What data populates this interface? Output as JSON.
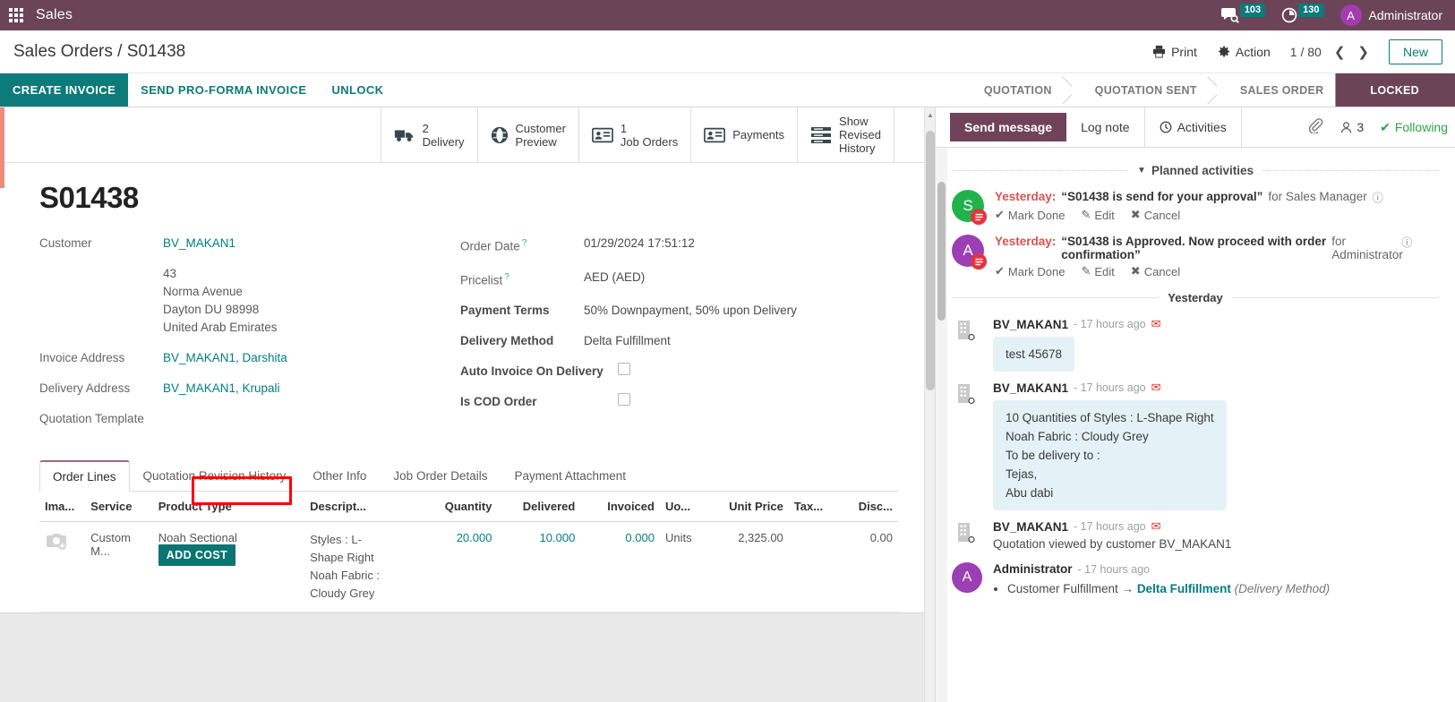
{
  "topbar": {
    "apps_icon": "apps-grid-icon",
    "app_name": "Sales",
    "messages_icon": "chat-bubble-icon",
    "messages_count": "103",
    "activities_icon": "clock-icon",
    "activities_count": "130",
    "user_initial": "A",
    "user_name": "Administrator"
  },
  "breadcrumb": {
    "text": "Sales Orders / S01438",
    "print_label": "Print",
    "print_icon": "printer-icon",
    "action_label": "Action",
    "action_icon": "gear-icon",
    "pager": "1 / 80",
    "prev_icon": "chevron-left-icon",
    "next_icon": "chevron-right-icon",
    "new_label": "New"
  },
  "actions": {
    "create_invoice": "CREATE INVOICE",
    "send_proforma": "SEND PRO-FORMA INVOICE",
    "unlock": "UNLOCK"
  },
  "statusbar": {
    "stages": [
      "QUOTATION",
      "QUOTATION SENT",
      "SALES ORDER",
      "LOCKED"
    ],
    "active": "LOCKED"
  },
  "smart_buttons": [
    {
      "count": "2",
      "label": "Delivery",
      "icon": "truck-icon"
    },
    {
      "count": "",
      "label_line1": "Customer",
      "label_line2": "Preview",
      "icon": "globe-icon"
    },
    {
      "count": "1",
      "label": "Job Orders",
      "icon": "id-card-icon"
    },
    {
      "count": "",
      "label": "Payments",
      "icon": "id-card-icon"
    },
    {
      "count": "",
      "label_line1": "Show",
      "label_line2": "Revised",
      "label_line3": "History",
      "icon": "list-icon"
    }
  ],
  "record": {
    "title": "S01438",
    "left_fields": {
      "customer_label": "Customer",
      "customer_value": "BV_MAKAN1",
      "address_lines": [
        "43",
        "Norma Avenue",
        "Dayton DU 98998",
        "United Arab Emirates"
      ],
      "invoice_address_label": "Invoice Address",
      "invoice_address_value": "BV_MAKAN1, Darshita",
      "delivery_address_label": "Delivery Address",
      "delivery_address_value": "BV_MAKAN1, Krupali",
      "quotation_template_label": "Quotation Template",
      "quotation_template_value": ""
    },
    "right_fields": {
      "order_date_label": "Order Date",
      "order_date_value": "01/29/2024 17:51:12",
      "pricelist_label": "Pricelist",
      "pricelist_value": "AED (AED)",
      "payment_terms_label": "Payment Terms",
      "payment_terms_value": "50% Downpayment, 50% upon Delivery",
      "delivery_method_label": "Delivery Method",
      "delivery_method_value": "Delta Fulfillment",
      "auto_invoice_label": "Auto Invoice On Delivery",
      "auto_invoice_checked": false,
      "is_cod_label": "Is COD Order",
      "is_cod_checked": false
    }
  },
  "notebook": {
    "tabs": [
      {
        "label": "Order Lines",
        "active": true
      },
      {
        "label": "Quotation Revision History",
        "active": false
      },
      {
        "label": "Other Info",
        "active": false
      },
      {
        "label": "Job Order Details",
        "active": false
      },
      {
        "label": "Payment Attachment",
        "active": false
      }
    ]
  },
  "order_lines": {
    "columns": [
      "Ima...",
      "Service",
      "Product Type",
      "Descript...",
      "Quantity",
      "Delivered",
      "Invoiced",
      "Uo...",
      "Unit Price",
      "Tax...",
      "Disc..."
    ],
    "rows": [
      {
        "image_icon": "camera-add-icon",
        "service": "Custom M...",
        "product_type": "Noah Sectional",
        "add_cost_label": "ADD COST",
        "description_lines": [
          "Styles : L-",
          "Shape Right",
          "Noah Fabric :",
          "Cloudy Grey"
        ],
        "quantity": "20.000",
        "delivered": "10.000",
        "invoiced": "0.000",
        "uom": "Units",
        "unit_price": "2,325.00",
        "tax": "",
        "discount": "0.00"
      }
    ]
  },
  "chatter": {
    "send_message_label": "Send message",
    "log_note_label": "Log note",
    "activities_label": "Activities",
    "activities_icon": "clock-icon",
    "attachment_icon": "paperclip-icon",
    "followers_icon": "user-icon",
    "followers_count": "3",
    "following_label": "Following",
    "following_icon": "check-icon",
    "planned_activities_title": "Planned activities",
    "planned_activities_caret": "caret-down-icon",
    "activities": [
      {
        "avatar_letter": "S",
        "avatar_color": "#21b24b",
        "badge_icon": "summary-icon",
        "when": "Yesterday:",
        "summary": "“S01438 is send for your approval”",
        "assigned_to": "for Sales Manager",
        "info_icon": "info-icon",
        "mark_done": "Mark Done",
        "edit": "Edit",
        "cancel": "Cancel"
      },
      {
        "avatar_letter": "A",
        "avatar_color": "#9b3fb5",
        "badge_icon": "summary-icon",
        "when": "Yesterday:",
        "summary": "“S01438 is Approved. Now proceed with order confirmation”",
        "assigned_to": "for Administrator",
        "info_icon": "info-icon",
        "mark_done": "Mark Done",
        "edit": "Edit",
        "cancel": "Cancel"
      }
    ],
    "day_divider": "Yesterday",
    "messages": [
      {
        "avatar_type": "company",
        "avatar_icon": "building-icon",
        "author": "BV_MAKAN1",
        "time": "- 17 hours ago",
        "status_icon": "envelope-icon",
        "bubble_lines": [
          "test 45678"
        ],
        "style": "bubble"
      },
      {
        "avatar_type": "company",
        "avatar_icon": "building-icon",
        "author": "BV_MAKAN1",
        "time": "- 17 hours ago",
        "status_icon": "envelope-icon",
        "bubble_lines": [
          "10 Quantities of Styles : L-Shape Right",
          "Noah Fabric : Cloudy Grey",
          "To be delivery to :",
          "Tejas,",
          "Abu dabi"
        ],
        "style": "bubble"
      },
      {
        "avatar_type": "company",
        "avatar_icon": "building-icon",
        "author": "BV_MAKAN1",
        "time": "- 17 hours ago",
        "status_icon": "envelope-icon",
        "plain_text": "Quotation viewed by customer BV_MAKAN1",
        "style": "plain"
      },
      {
        "avatar_type": "user",
        "avatar_letter": "A",
        "avatar_color": "#9b3fb5",
        "author": "Administrator",
        "time": "- 17 hours ago",
        "style": "tracking",
        "tracking": {
          "old_value": "Customer Fulfillment",
          "arrow": "→",
          "new_value": "Delta Fulfillment",
          "field": "(Delivery Method)"
        }
      }
    ]
  },
  "colors": {
    "brand_purple": "#6b4458",
    "teal": "#0d7b79",
    "badge_teal": "#0d7b79",
    "highlight_red": "#ff0000",
    "link_teal": "#017e84",
    "activity_red": "#d9534f",
    "following_green": "#28a745"
  }
}
